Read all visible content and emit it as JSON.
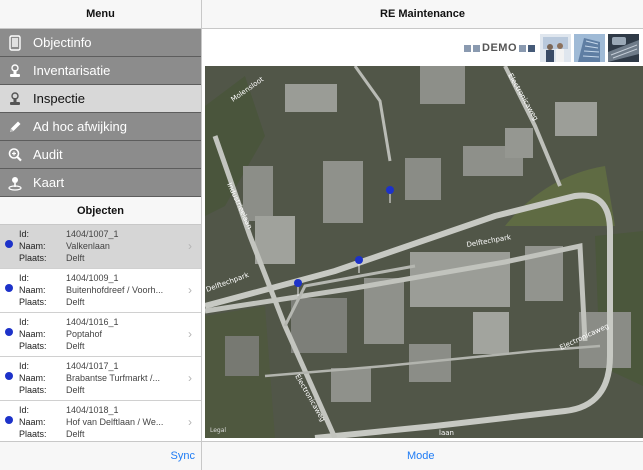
{
  "left_nav": {
    "title": "Menu"
  },
  "menu": [
    {
      "label": "Objectinfo",
      "icon": "tablet-icon",
      "active": false
    },
    {
      "label": "Inventarisatie",
      "icon": "stamp-icon",
      "active": false
    },
    {
      "label": "Inspectie",
      "icon": "stamp-icon",
      "active": true
    },
    {
      "label": "Ad hoc afwijking",
      "icon": "pencil-icon",
      "active": false
    },
    {
      "label": "Audit",
      "icon": "magnifier-icon",
      "active": false
    },
    {
      "label": "Kaart",
      "icon": "map-pin-icon",
      "active": false
    }
  ],
  "objects": {
    "title": "Objecten",
    "labels": {
      "id": "Id:",
      "naam": "Naam:",
      "plaats": "Plaats:"
    },
    "items": [
      {
        "id": "1404/1007_1",
        "naam": "Valkenlaan",
        "plaats": "Delft",
        "selected": true
      },
      {
        "id": "1404/1009_1",
        "naam": "Buitenhofdreef / Voorh...",
        "plaats": "Delft",
        "selected": false
      },
      {
        "id": "1404/1016_1",
        "naam": "Poptahof",
        "plaats": "Delft",
        "selected": false
      },
      {
        "id": "1404/1017_1",
        "naam": "Brabantse Turfmarkt /...",
        "plaats": "Delft",
        "selected": false
      },
      {
        "id": "1404/1018_1",
        "naam": "Hof van Delftlaan / We...",
        "plaats": "Delft",
        "selected": false
      }
    ]
  },
  "left_toolbar": {
    "sync_label": "Sync"
  },
  "right_nav": {
    "title": "RE Maintenance"
  },
  "brand": {
    "logo_text": "DEMO"
  },
  "map": {
    "labels": {
      "mol": "Molensloot",
      "ilaan": "Industrieelaan",
      "delft": "Delftechpark",
      "elec1": "Electronicaweg",
      "elec2": "Electronicaweg",
      "lefttop": "Delftechpark",
      "laan": "laan",
      "right": "Electronicaweg",
      "legal": "Legal"
    },
    "pin_color": "#1d32c9"
  },
  "right_toolbar": {
    "mode_label": "Mode"
  }
}
